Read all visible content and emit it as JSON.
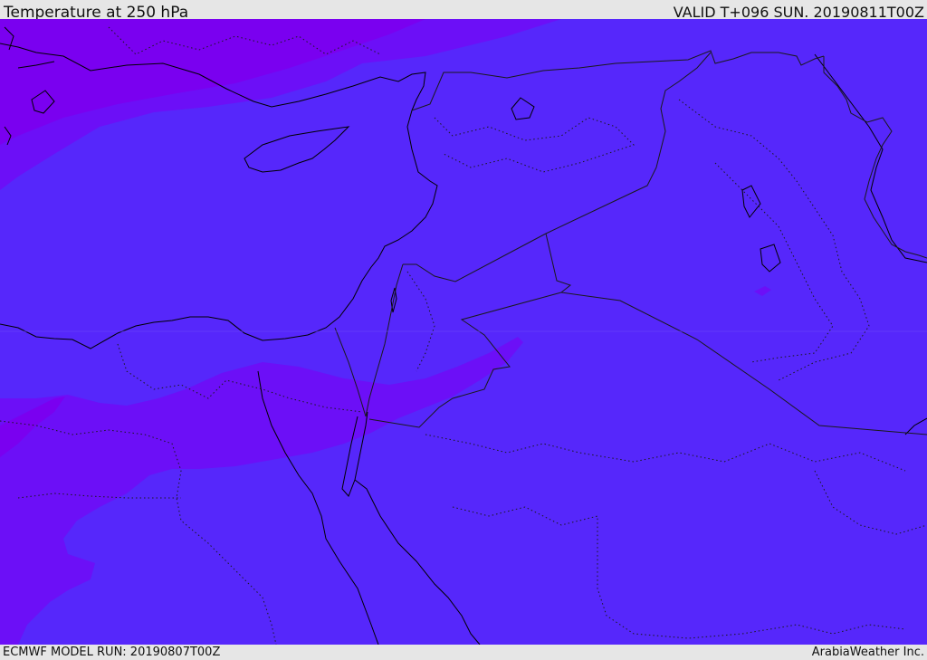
{
  "header": {
    "title": "Temperature at 250 hPa",
    "valid": "VALID T+096 SUN. 20190811T00Z"
  },
  "footer": {
    "model_run": "ECMWF MODEL RUN: 20190807T00Z",
    "credit": "ArabiaWeather Inc."
  },
  "map": {
    "field": "temperature-250hPa",
    "colors": {
      "field_main": "#5627fb",
      "field_colder": "#6c0ff7",
      "field_coldest": "#7a00f0",
      "coastline": "#000000",
      "border": "#222222"
    }
  }
}
